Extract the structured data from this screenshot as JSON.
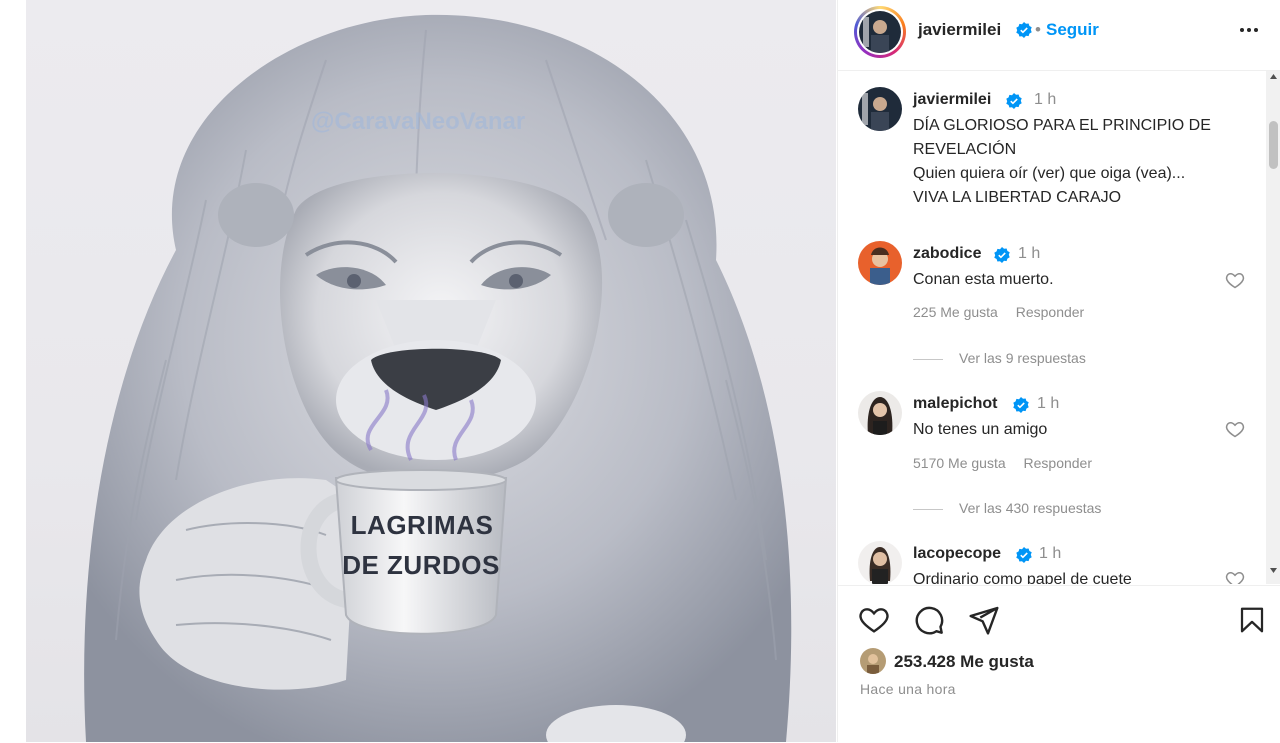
{
  "post": {
    "mug_text_line1": "LAGRIMAS",
    "mug_text_line2": "DE ZURDOS",
    "watermark": "@CaravaNeoVanar"
  },
  "header": {
    "username": "javiermilei",
    "dot": "•",
    "follow_label": "Seguir",
    "more_icon": "more-horizontal-icon"
  },
  "caption": {
    "username": "javiermilei",
    "time": "1 h",
    "line1": "DÍA GLORIOSO PARA EL PRINCIPIO DE",
    "line2": "REVELACIÓN",
    "line3": "Quien quiera oír (ver) que oiga (vea)...",
    "line4": "VIVA LA LIBERTAD CARAJO"
  },
  "comments": [
    {
      "username": "zabodice",
      "time": "1 h",
      "text": "Conan esta muerto.",
      "likes": "225 Me gusta",
      "reply_label": "Responder",
      "view_replies": "Ver las 9 respuestas"
    },
    {
      "username": "malepichot",
      "time": "1 h",
      "text": "No tenes un amigo",
      "likes": "5170 Me gusta",
      "reply_label": "Responder",
      "view_replies": "Ver las 430 respuestas"
    },
    {
      "username": "lacopecope",
      "time": "1 h",
      "text": "Ordinario como papel de cuete"
    }
  ],
  "footer": {
    "likes_count": "253.428 Me gusta",
    "time_ago": "Hace una hora"
  },
  "colors": {
    "accent": "#0095f6",
    "verified": "#0095f6",
    "muted": "#8e8e8e"
  }
}
